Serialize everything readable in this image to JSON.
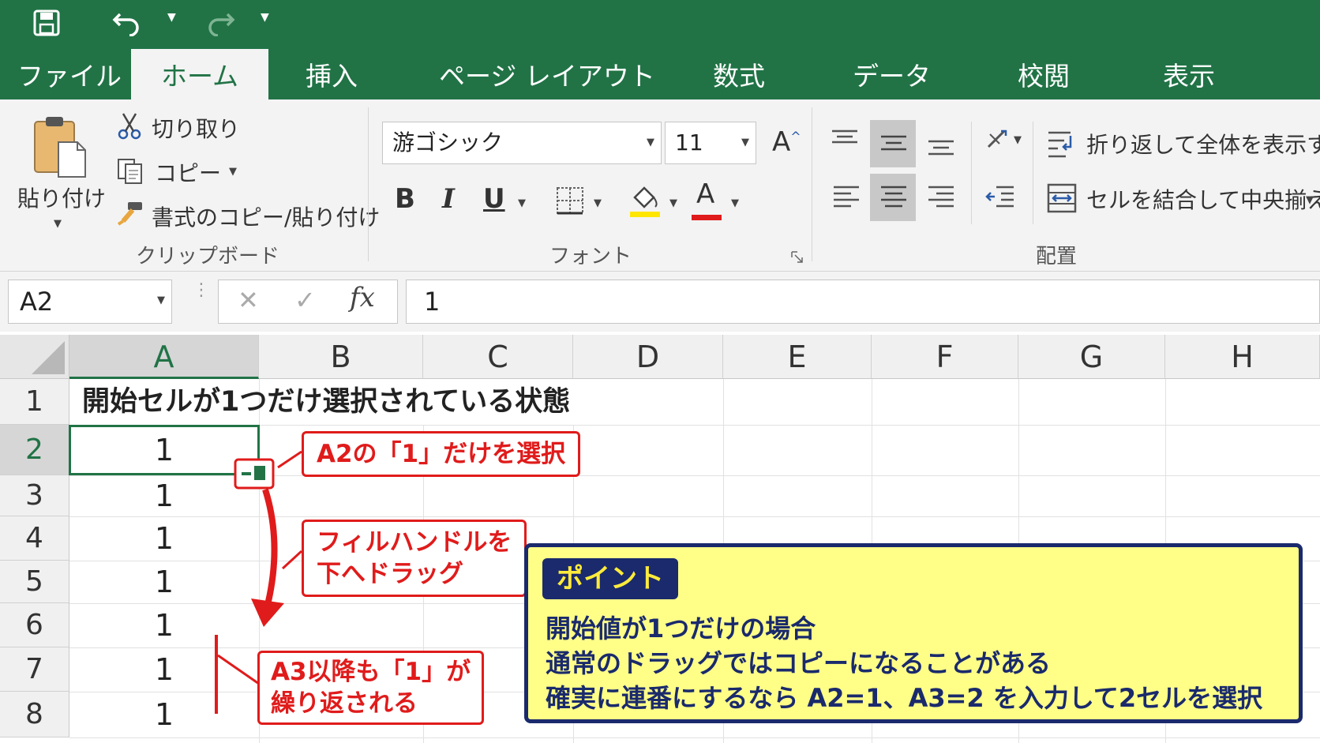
{
  "quick_access": {
    "save_icon": "save-icon",
    "undo_icon": "undo-icon",
    "redo_icon": "redo-icon"
  },
  "tabs": [
    {
      "label": "ファイル"
    },
    {
      "label": "ホーム",
      "active": true
    },
    {
      "label": "挿入"
    },
    {
      "label": "ページ レイアウト"
    },
    {
      "label": "数式"
    },
    {
      "label": "データ"
    },
    {
      "label": "校閲"
    },
    {
      "label": "表示"
    }
  ],
  "ribbon": {
    "clipboard": {
      "paste_label": "貼り付け",
      "cut_label": "切り取り",
      "copy_label": "コピー",
      "format_painter_label": "書式のコピー/貼り付け",
      "group_label": "クリップボード"
    },
    "font": {
      "font_name": "游ゴシック",
      "font_size": "11",
      "bold": "B",
      "italic": "I",
      "underline": "U",
      "font_color_letter": "A",
      "grow_letter": "A",
      "group_label": "フォント"
    },
    "alignment": {
      "wrap_text_label": "折り返して全体を表示する",
      "merge_center_label": "セルを結合して中央揃え",
      "group_label": "配置"
    }
  },
  "formula_bar": {
    "name_box": "A2",
    "fx": "fx",
    "value": "1"
  },
  "columns": [
    "A",
    "B",
    "C",
    "D",
    "E",
    "F",
    "G",
    "H"
  ],
  "rows": [
    "1",
    "2",
    "3",
    "4",
    "5",
    "6",
    "7",
    "8"
  ],
  "cells": {
    "A1": "開始セルが1つだけ選択されている状態",
    "A2": "1",
    "A3": "1",
    "A4": "1",
    "A5": "1",
    "A6": "1",
    "A7": "1",
    "A8": "1"
  },
  "callouts": {
    "select": "A2の「1」だけを選択",
    "drag_line1": "フィルハンドルを",
    "drag_line2": "下へドラッグ",
    "repeat_line1": "A3以降も「1」が",
    "repeat_line2": "繰り返される"
  },
  "point": {
    "title": "ポイント",
    "lines": [
      "開始値が1つだけの場合",
      "通常のドラッグではコピーになることがある",
      "確実に連番にするなら A2=1、A3=2 を入力して2セルを選択"
    ]
  },
  "colors": {
    "excel_green": "#217346",
    "callout_red": "#e01b1b",
    "point_bg": "#ffff88",
    "point_navy": "#1a2a6c"
  }
}
